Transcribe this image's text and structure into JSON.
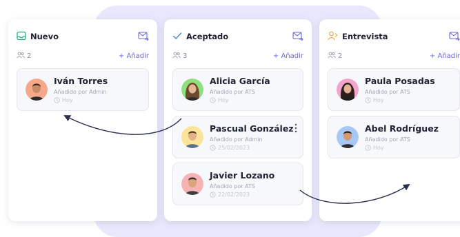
{
  "columns": [
    {
      "title": "Nuevo",
      "count": "2",
      "add_label": "+ Añadir",
      "cards": [
        {
          "name": "Iván Torres",
          "added_by": "Añadido por Admin",
          "date": "Hoy"
        }
      ]
    },
    {
      "title": "Aceptado",
      "count": "3",
      "add_label": "+ Añadir",
      "cards": [
        {
          "name": "Alicia García",
          "added_by": "Añadido por ATS",
          "date": "Hoy"
        },
        {
          "name": "Pascual González",
          "added_by": "Añadido por Admin",
          "date": "25/02/2023"
        },
        {
          "name": "Javier Lozano",
          "added_by": "Añadido por ATS",
          "date": "22/02/2023"
        }
      ]
    },
    {
      "title": "Entrevista",
      "count": "2",
      "add_label": "+ Añadir",
      "cards": [
        {
          "name": "Paula Posadas",
          "added_by": "Añadido por ATS",
          "date": "Hoy"
        },
        {
          "name": "Abel Rodríguez",
          "added_by": "Añadido por ATS",
          "date": "Hoy"
        }
      ]
    }
  ],
  "colors": {
    "accent": "#6b67e0",
    "nuevo_icon": "#22b07a",
    "aceptado_icon": "#4a8be8",
    "entrevista_icon": "#f2a93b",
    "background_blob": "#e7e8fb",
    "arrow": "#2c3152"
  },
  "icons": [
    "inbox-icon",
    "check-icon",
    "user-clock-icon",
    "mail-forward-icon",
    "users-icon",
    "clock-icon",
    "more-vertical-icon"
  ]
}
